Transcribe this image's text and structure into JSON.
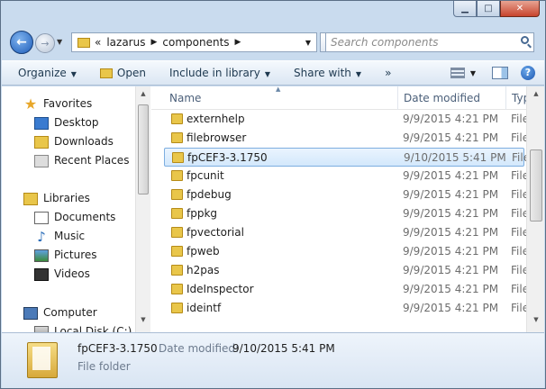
{
  "address": {
    "overflow": "«",
    "crumbs": [
      "lazarus",
      "components"
    ],
    "search_placeholder": "Search components"
  },
  "toolbar": {
    "organize": "Organize",
    "open": "Open",
    "include": "Include in library",
    "share": "Share with",
    "more": "»"
  },
  "nav": {
    "favorites": "Favorites",
    "desktop": "Desktop",
    "downloads": "Downloads",
    "recent": "Recent Places",
    "libraries": "Libraries",
    "documents": "Documents",
    "music": "Music",
    "pictures": "Pictures",
    "videos": "Videos",
    "computer": "Computer",
    "localdisk": "Local Disk (C:)"
  },
  "columns": {
    "name": "Name",
    "date": "Date modified",
    "type": "Typ"
  },
  "files": [
    {
      "name": "externhelp",
      "date": "9/9/2015 4:21 PM",
      "type": "File"
    },
    {
      "name": "filebrowser",
      "date": "9/9/2015 4:21 PM",
      "type": "File"
    },
    {
      "name": "fpCEF3-3.1750",
      "date": "9/10/2015 5:41 PM",
      "type": "File"
    },
    {
      "name": "fpcunit",
      "date": "9/9/2015 4:21 PM",
      "type": "File"
    },
    {
      "name": "fpdebug",
      "date": "9/9/2015 4:21 PM",
      "type": "File"
    },
    {
      "name": "fppkg",
      "date": "9/9/2015 4:21 PM",
      "type": "File"
    },
    {
      "name": "fpvectorial",
      "date": "9/9/2015 4:21 PM",
      "type": "File"
    },
    {
      "name": "fpweb",
      "date": "9/9/2015 4:21 PM",
      "type": "File"
    },
    {
      "name": "h2pas",
      "date": "9/9/2015 4:21 PM",
      "type": "File"
    },
    {
      "name": "IdeInspector",
      "date": "9/9/2015 4:21 PM",
      "type": "File"
    },
    {
      "name": "ideintf",
      "date": "9/9/2015 4:21 PM",
      "type": "File"
    }
  ],
  "details": {
    "name": "fpCEF3-3.1750",
    "date_label": "Date modified:",
    "date": "9/10/2015 5:41 PM",
    "type": "File folder"
  }
}
